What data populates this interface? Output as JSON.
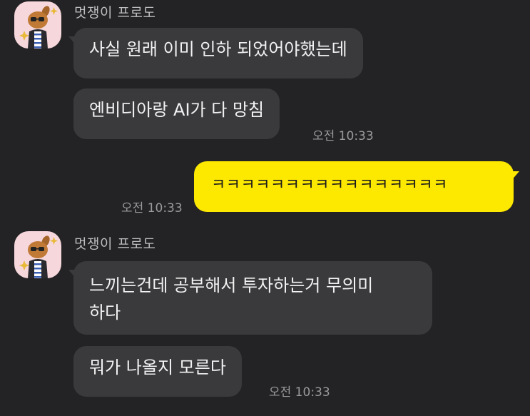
{
  "chat": {
    "groups": [
      {
        "sender": "멋쟁이 프로도",
        "messages": [
          {
            "text": "사실 원래 이미 인하 되었어야했는데"
          },
          {
            "text": "엔비디아랑 AI가 다 망침",
            "time": "오전 10:33"
          }
        ]
      },
      {
        "mine": true,
        "messages": [
          {
            "text": "ㅋㅋㅋㅋㅋㅋㅋㅋㅋㅋㅋㅋㅋㅋㅋㅋ",
            "time": "오전 10:33"
          }
        ]
      },
      {
        "sender": "멋쟁이 프로도",
        "messages": [
          {
            "text": "느끼는건데 공부해서 투자하는거 무의미\n하다"
          },
          {
            "text": "뭐가 나올지 모른다",
            "time": "오전 10:33"
          }
        ]
      }
    ]
  },
  "colors": {
    "background": "#232325",
    "bubble_other": "#3a3a3d",
    "bubble_mine": "#fde800",
    "avatar_bg": "#f6d7dc"
  },
  "icons": {
    "avatar": "frodo-character-avatar-icon"
  }
}
